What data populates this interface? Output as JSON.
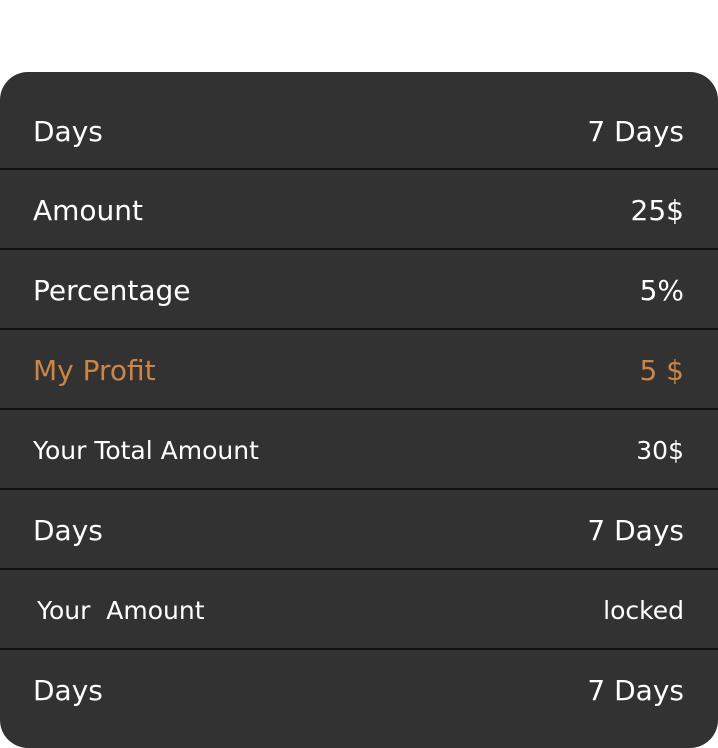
{
  "colors": {
    "card_bg": "#323232",
    "divider": "#111111",
    "text": "#ffffff",
    "accent": "#cd8447"
  },
  "rows": [
    {
      "label": "Days",
      "value": "7 Days"
    },
    {
      "label": "Amount",
      "value": "25$"
    },
    {
      "label": "Percentage",
      "value": "5%"
    },
    {
      "label": "My Profit",
      "value": "5 $"
    },
    {
      "label": "Your Total Amount",
      "value": "30$"
    },
    {
      "label": "Days",
      "value": "7 Days"
    },
    {
      "label": "Your  Amount",
      "value": "locked"
    },
    {
      "label": "Days",
      "value": "7 Days"
    }
  ]
}
